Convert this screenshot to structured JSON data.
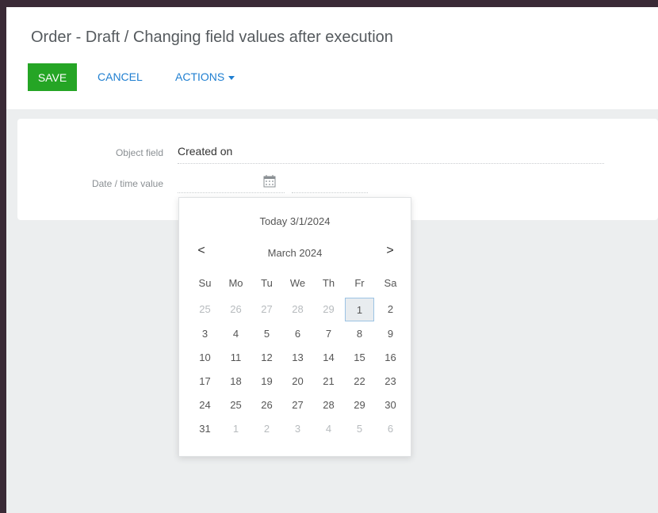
{
  "header": {
    "title": "Order - Draft / Changing field values after execution",
    "save_label": "SAVE",
    "cancel_label": "CANCEL",
    "actions_label": "ACTIONS"
  },
  "form": {
    "object_field_label": "Object field",
    "object_field_value": "Created on",
    "datetime_label": "Date / time value"
  },
  "datepicker": {
    "today_label": "Today 3/1/2024",
    "month_label": "March 2024",
    "prev_icon": "<",
    "next_icon": ">",
    "weekdays": [
      "Su",
      "Mo",
      "Tu",
      "We",
      "Th",
      "Fr",
      "Sa"
    ],
    "weeks": [
      [
        "25",
        "26",
        "27",
        "28",
        "29",
        "1",
        "2"
      ],
      [
        "3",
        "4",
        "5",
        "6",
        "7",
        "8",
        "9"
      ],
      [
        "10",
        "11",
        "12",
        "13",
        "14",
        "15",
        "16"
      ],
      [
        "17",
        "18",
        "19",
        "20",
        "21",
        "22",
        "23"
      ],
      [
        "24",
        "25",
        "26",
        "27",
        "28",
        "29",
        "30"
      ],
      [
        "31",
        "1",
        "2",
        "3",
        "4",
        "5",
        "6"
      ]
    ],
    "selected_day": "1"
  },
  "colors": {
    "save_bg": "#25a525",
    "link": "#1f7fd1",
    "muted_day": "#b7bbbe",
    "today_border": "#9cc3e4"
  },
  "icons": [
    "calendar-icon",
    "chevron-left-icon",
    "chevron-right-icon",
    "caret-down-icon"
  ]
}
